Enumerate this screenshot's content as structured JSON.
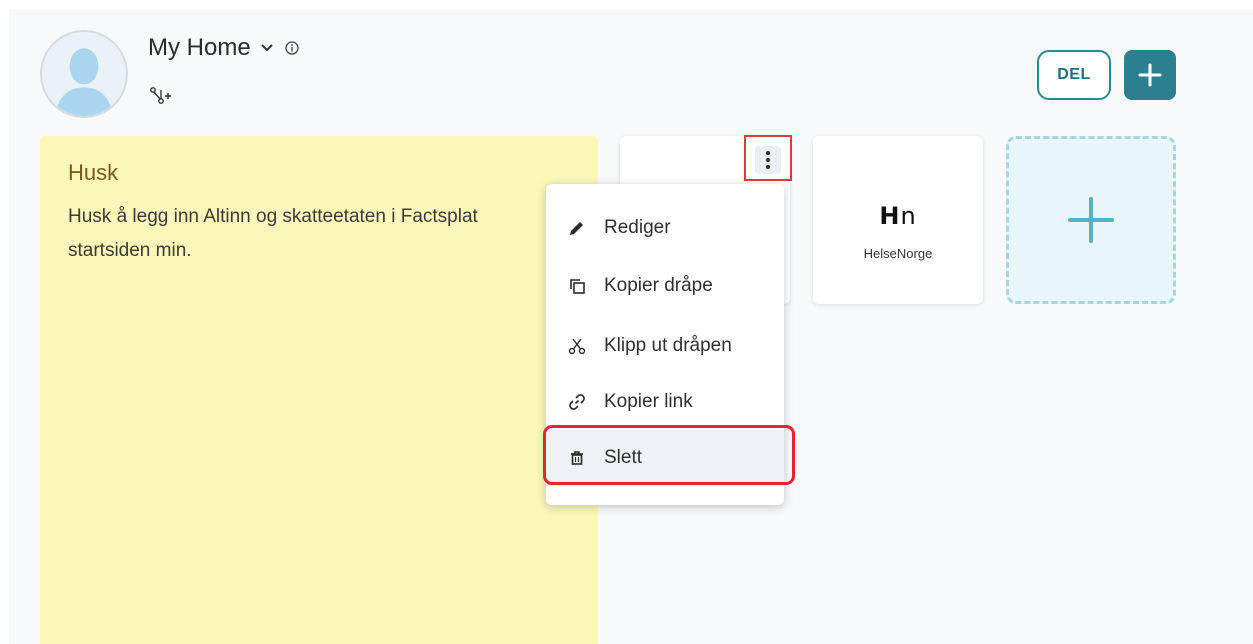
{
  "header": {
    "title": "My Home",
    "icons": [
      "avatar",
      "chevron-down-icon",
      "info-icon",
      "share-network-icon"
    ],
    "del_label": "DEL",
    "add_icon": "plus-icon",
    "accent": "#2b7f8f"
  },
  "note": {
    "title": "Husk",
    "body": "Husk å legg inn Altinn og skatteetaten i Factsplat startsiden min.",
    "color": "#faf7b9"
  },
  "tiles": [
    {
      "name": "",
      "icon": "kebab-menu-icon"
    },
    {
      "name": "HelseNorge",
      "logo_text": "Hn"
    }
  ],
  "add_tile": {
    "icon": "plus-icon"
  },
  "context_menu": {
    "items": [
      {
        "label": "Rediger",
        "icon": "pencil-icon"
      },
      {
        "label": "Kopier dråpe",
        "icon": "copy-icon"
      },
      {
        "label": "Klipp ut dråpen",
        "icon": "cut-icon"
      },
      {
        "label": "Kopier link",
        "icon": "link-icon"
      },
      {
        "label": "Slett",
        "icon": "trash-icon",
        "highlighted": true
      }
    ]
  },
  "annotations": {
    "highlight_color": "#e8232b"
  }
}
